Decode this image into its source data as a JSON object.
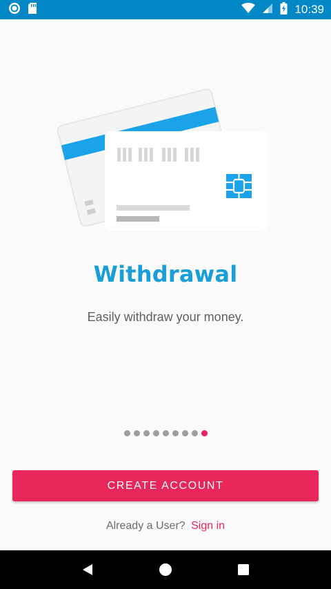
{
  "status_bar": {
    "time": "10:39",
    "icons": [
      "app-notification-icon",
      "sd-card-icon",
      "wifi-icon",
      "signal-icon",
      "battery-charging-icon"
    ]
  },
  "onboarding": {
    "title": "Withdrawal",
    "subtitle": "Easily withdraw your money.",
    "page_count": 9,
    "current_page": 9
  },
  "actions": {
    "create_account_label": "CREATE ACCOUNT",
    "already_user_text": "Already a User?",
    "sign_in_label": "Sign in"
  },
  "nav_bar": {
    "icons": [
      "back-icon",
      "home-icon",
      "recents-icon"
    ]
  },
  "colors": {
    "status_bar": "#0288c7",
    "title": "#1a9ed8",
    "accent": "#e9265a",
    "card_stripe": "#1aa3e8"
  }
}
